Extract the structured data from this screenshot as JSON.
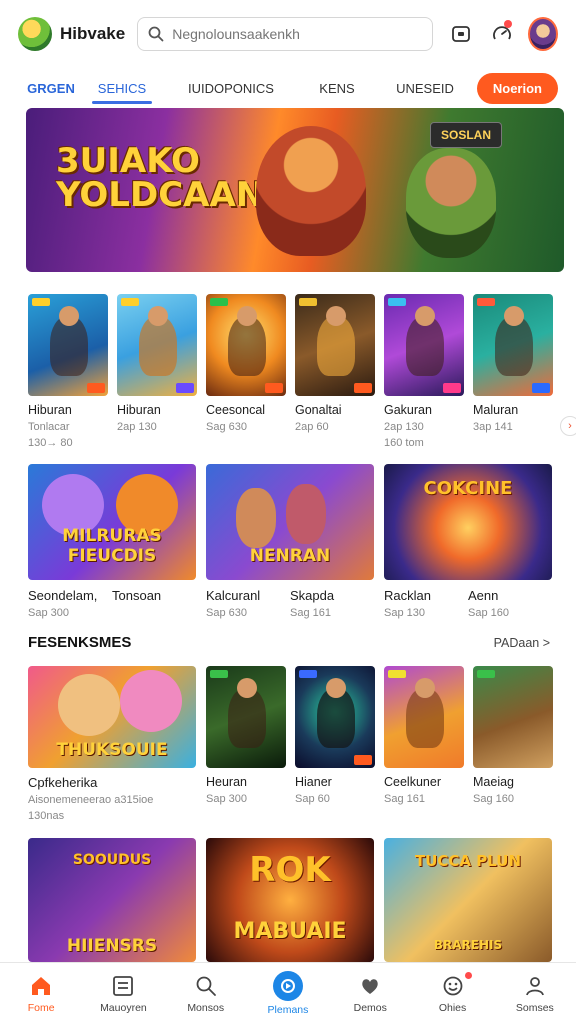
{
  "header": {
    "brand": "Hibvake",
    "search_placeholder": "Negnolounsaakenkh"
  },
  "tabs": [
    {
      "label": "GRGEN"
    },
    {
      "label": "SEHICS"
    },
    {
      "label": "IUIDOPONICS"
    },
    {
      "label": "KENS"
    },
    {
      "label": "UNESEID"
    }
  ],
  "tab_button": "Noerion",
  "banner": {
    "title_line1": "3UIAKO",
    "title_line2": "YOLDCAAN",
    "badge": "SOSLAN"
  },
  "row1": [
    {
      "title": "Hiburan",
      "sub1": "Tonlacar",
      "sub2": "130→ 80"
    },
    {
      "title": "Hiburan",
      "sub1": "2ap 130",
      "sub2": ""
    },
    {
      "title": "Ceesoncal",
      "sub1": "Sag 630",
      "sub2": ""
    },
    {
      "title": "Gonaltai",
      "sub1": "2ap 60",
      "sub2": ""
    },
    {
      "title": "Gakuran",
      "sub1": "2ap 130",
      "sub2": "160 tom"
    },
    {
      "title": "Maluran",
      "sub1": "3ap 141",
      "sub2": ""
    }
  ],
  "row2": [
    {
      "title_a": "Seondelam,",
      "sub_a": "Sap 300",
      "title_b": "Tonsoan",
      "sub_b": "",
      "art": "MILRURAS FIEUCDIS"
    },
    {
      "title_a": "Kalcuranl",
      "sub_a": "Sap 630",
      "title_b": "Skapda",
      "sub_b": "Sag 161",
      "art": "NENRAN"
    },
    {
      "title_a": "Racklan",
      "sub_a": "Sap 130",
      "title_b": "Aenn",
      "sub_b": "Sap 160",
      "art": "COKCINE"
    }
  ],
  "section": {
    "title": "FESENKSMES",
    "more": "PADaan >"
  },
  "row3": [
    {
      "title": "Cpfkeherika",
      "sub1": "Aisonemeneerao a315ioe",
      "sub2": "130nas",
      "big": true,
      "art": "THUKSOUIE"
    },
    {
      "title": "Heuran",
      "sub1": "Sap 300",
      "sub2": ""
    },
    {
      "title": "Hianer",
      "sub1": "Sap 60",
      "sub2": ""
    },
    {
      "title": "Ceelkuner",
      "sub1": "Sag 161",
      "sub2": ""
    },
    {
      "title": "Maeiag",
      "sub1": "Sag 160",
      "sub2": ""
    }
  ],
  "row4": [
    {
      "art_top": "SOOUDUS",
      "art": "HIIENSRS"
    },
    {
      "art_top": "ROK",
      "art": "MABUAIE"
    },
    {
      "art_top": "TUCCA PLUN",
      "art": "BRAREHIS"
    }
  ],
  "bottom_nav": [
    {
      "label": "Fome",
      "icon": "home-icon"
    },
    {
      "label": "Mauoyren",
      "icon": "list-icon"
    },
    {
      "label": "Monsos",
      "icon": "search-icon"
    },
    {
      "label": "Plemans",
      "icon": "compass-icon"
    },
    {
      "label": "Demos",
      "icon": "heart-icon"
    },
    {
      "label": "Ohies",
      "icon": "smiley-icon"
    },
    {
      "label": "Somses",
      "icon": "person-icon"
    }
  ],
  "colors": {
    "accent": "#ff5a1f",
    "tab_blue": "#2a66d9",
    "nav_blue": "#1d86e6"
  }
}
